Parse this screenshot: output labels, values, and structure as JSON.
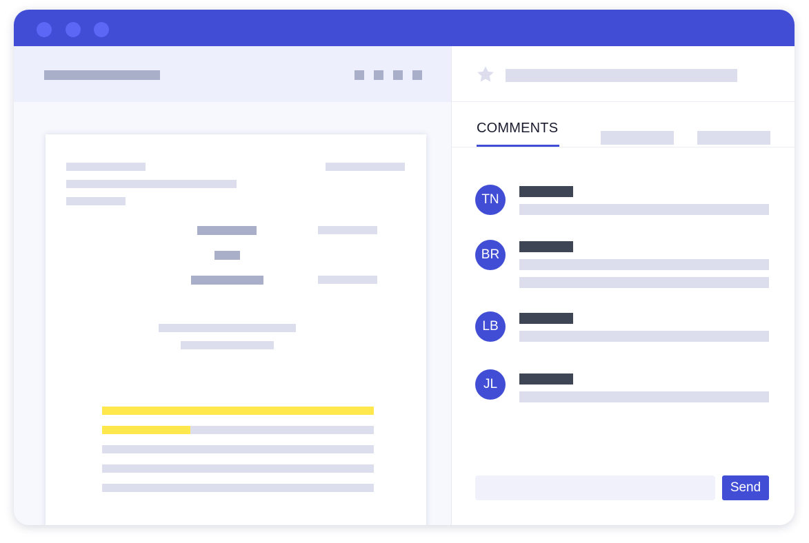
{
  "colors": {
    "accent": "#414dd4",
    "window_dot": "#5d67f5",
    "highlight": "#ffe84d"
  },
  "left_pane": {
    "toolbar_icons": [
      "square-icon",
      "square-icon",
      "square-icon",
      "square-icon"
    ]
  },
  "right_pane": {
    "header_icon": "star-icon",
    "tabs": [
      {
        "label": "COMMENTS",
        "active": true
      },
      {
        "label": "",
        "active": false
      },
      {
        "label": "",
        "active": false
      }
    ],
    "comments": [
      {
        "initials": "TN"
      },
      {
        "initials": "BR"
      },
      {
        "initials": "LB"
      },
      {
        "initials": "JL"
      }
    ],
    "composer": {
      "placeholder": "",
      "send_label": "Send"
    }
  }
}
